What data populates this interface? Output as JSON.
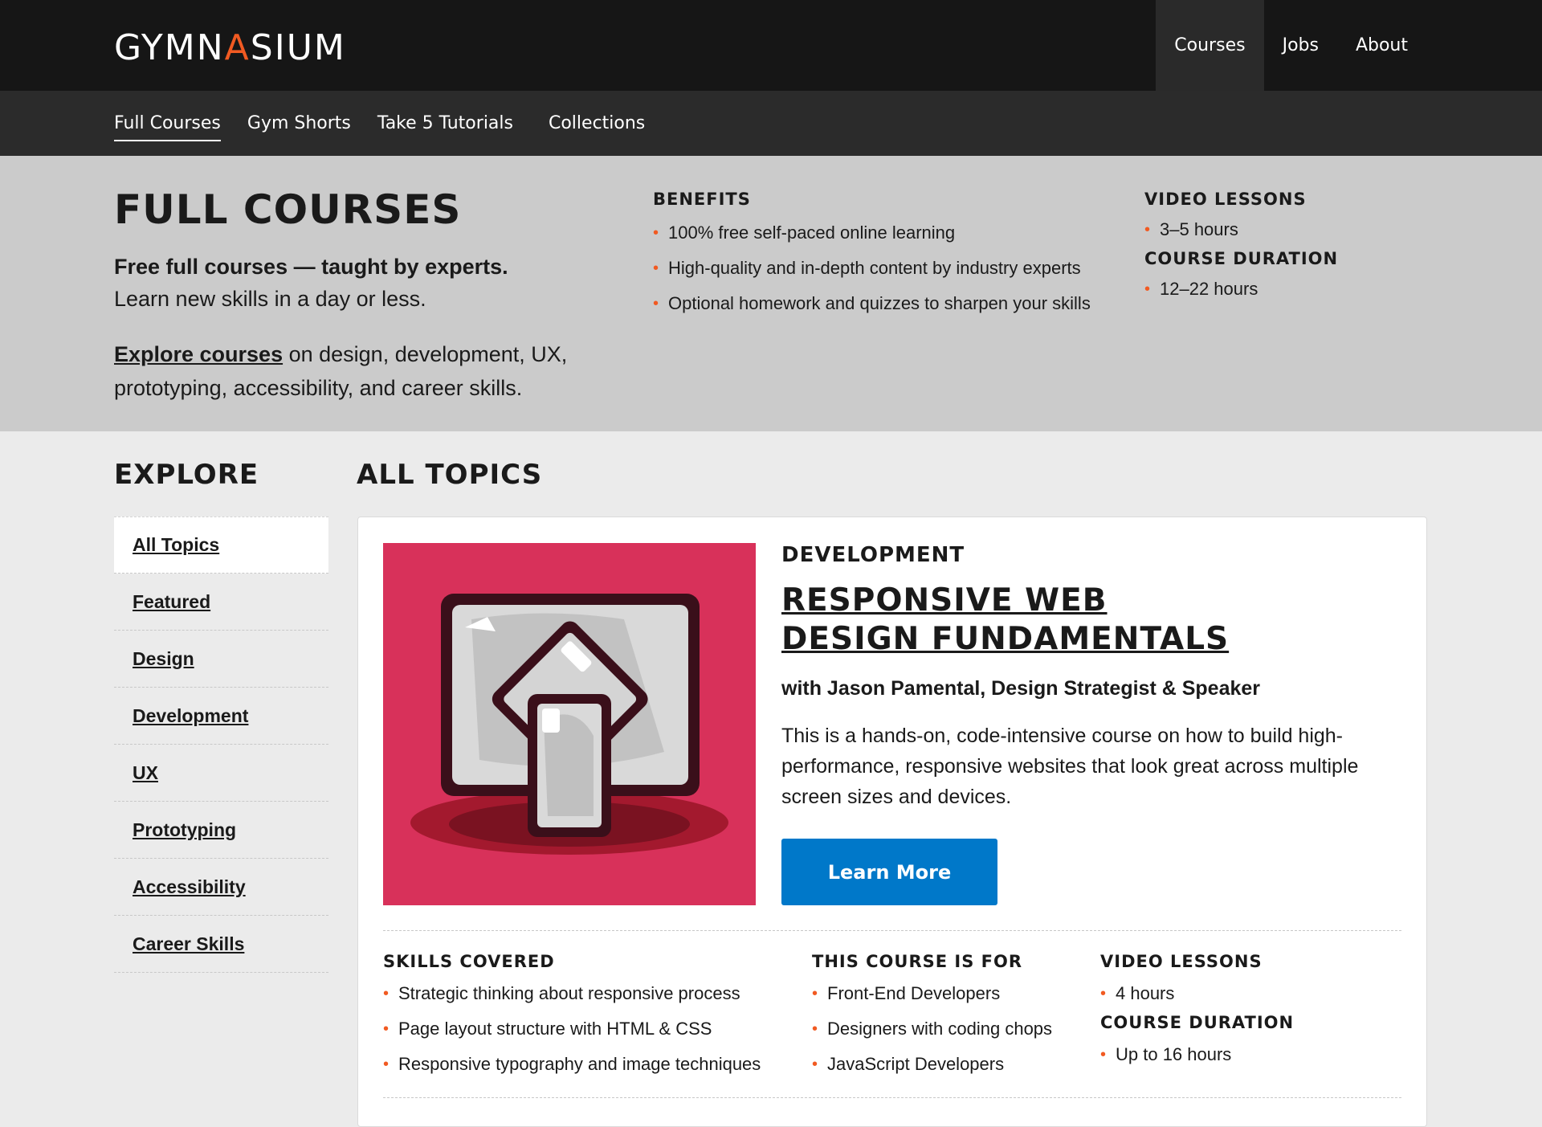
{
  "brand": {
    "logo_pre": "GYMN",
    "logo_accent": "A",
    "logo_post": "SIUM"
  },
  "topnav": [
    {
      "label": "Courses",
      "active": true
    },
    {
      "label": "Jobs"
    },
    {
      "label": "About"
    }
  ],
  "subnav": [
    {
      "label": "Full Courses",
      "active": true
    },
    {
      "label": "Gym Shorts"
    },
    {
      "label": "Take 5 Tutorials"
    },
    {
      "label": "Collections"
    }
  ],
  "hero": {
    "title": "FULL COURSES",
    "tagline": "Free full courses — taught by experts.",
    "subline": "Learn new skills in a day or less.",
    "explore_link": "Explore courses",
    "explore_rest": " on design, development, UX, prototyping, accessibility, and career skills.",
    "benefits": {
      "heading": "BENEFITS",
      "items": [
        "100% free self-paced online learning",
        "High-quality and in-depth content by industry experts",
        "Optional homework and quizzes to sharpen your skills"
      ]
    },
    "video": {
      "heading": "VIDEO LESSONS",
      "value": "3–5 hours"
    },
    "duration": {
      "heading": "COURSE DURATION",
      "value": "12–22 hours"
    }
  },
  "explore": {
    "heading": "EXPLORE",
    "items": [
      "All Topics",
      "Featured",
      "Design",
      "Development",
      "UX",
      "Prototyping",
      "Accessibility",
      "Career Skills"
    ]
  },
  "topics": {
    "heading": "ALL TOPICS",
    "card": {
      "category": "DEVELOPMENT",
      "title": "RESPONSIVE WEB DESIGN FUNDAMENTALS",
      "instructor": "with Jason Pamental, Design Strategist & Speaker",
      "description": "This is a hands-on, code-intensive course on how to build high-performance, responsive websites that look great across multiple screen sizes and devices.",
      "button": "Learn More",
      "skills": {
        "heading": "SKILLS COVERED",
        "items": [
          "Strategic thinking about responsive process",
          "Page layout structure with HTML & CSS",
          "Responsive typography and image techniques"
        ]
      },
      "audience": {
        "heading": "THIS COURSE IS FOR",
        "items": [
          "Front-End Developers",
          "Designers with coding chops",
          "JavaScript Developers"
        ]
      },
      "video": {
        "heading": "VIDEO LESSONS",
        "value": "4 hours"
      },
      "duration": {
        "heading": "COURSE DURATION",
        "value": "Up to 16 hours"
      }
    }
  },
  "colors": {
    "accent": "#f15a22",
    "button": "#0078c9",
    "thumb_bg": "#d8315a"
  }
}
